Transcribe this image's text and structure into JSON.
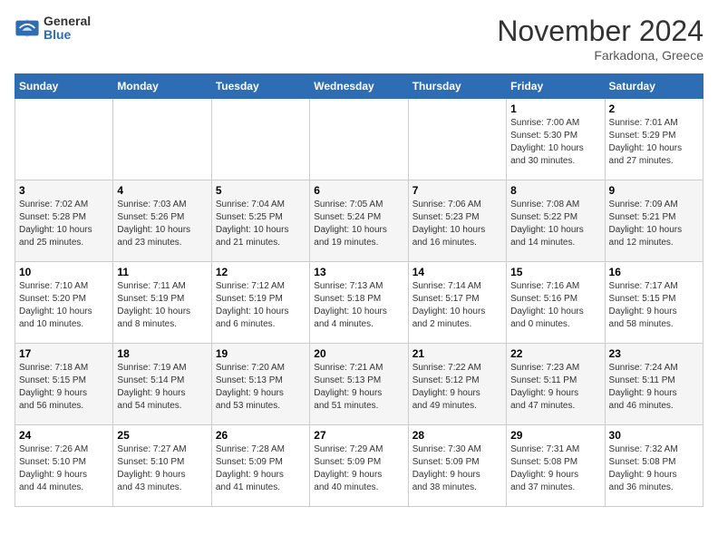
{
  "header": {
    "logo_general": "General",
    "logo_blue": "Blue",
    "month_title": "November 2024",
    "location": "Farkadona, Greece"
  },
  "days_of_week": [
    "Sunday",
    "Monday",
    "Tuesday",
    "Wednesday",
    "Thursday",
    "Friday",
    "Saturday"
  ],
  "weeks": [
    [
      {
        "day": "",
        "info": ""
      },
      {
        "day": "",
        "info": ""
      },
      {
        "day": "",
        "info": ""
      },
      {
        "day": "",
        "info": ""
      },
      {
        "day": "",
        "info": ""
      },
      {
        "day": "1",
        "info": "Sunrise: 7:00 AM\nSunset: 5:30 PM\nDaylight: 10 hours\nand 30 minutes."
      },
      {
        "day": "2",
        "info": "Sunrise: 7:01 AM\nSunset: 5:29 PM\nDaylight: 10 hours\nand 27 minutes."
      }
    ],
    [
      {
        "day": "3",
        "info": "Sunrise: 7:02 AM\nSunset: 5:28 PM\nDaylight: 10 hours\nand 25 minutes."
      },
      {
        "day": "4",
        "info": "Sunrise: 7:03 AM\nSunset: 5:26 PM\nDaylight: 10 hours\nand 23 minutes."
      },
      {
        "day": "5",
        "info": "Sunrise: 7:04 AM\nSunset: 5:25 PM\nDaylight: 10 hours\nand 21 minutes."
      },
      {
        "day": "6",
        "info": "Sunrise: 7:05 AM\nSunset: 5:24 PM\nDaylight: 10 hours\nand 19 minutes."
      },
      {
        "day": "7",
        "info": "Sunrise: 7:06 AM\nSunset: 5:23 PM\nDaylight: 10 hours\nand 16 minutes."
      },
      {
        "day": "8",
        "info": "Sunrise: 7:08 AM\nSunset: 5:22 PM\nDaylight: 10 hours\nand 14 minutes."
      },
      {
        "day": "9",
        "info": "Sunrise: 7:09 AM\nSunset: 5:21 PM\nDaylight: 10 hours\nand 12 minutes."
      }
    ],
    [
      {
        "day": "10",
        "info": "Sunrise: 7:10 AM\nSunset: 5:20 PM\nDaylight: 10 hours\nand 10 minutes."
      },
      {
        "day": "11",
        "info": "Sunrise: 7:11 AM\nSunset: 5:19 PM\nDaylight: 10 hours\nand 8 minutes."
      },
      {
        "day": "12",
        "info": "Sunrise: 7:12 AM\nSunset: 5:19 PM\nDaylight: 10 hours\nand 6 minutes."
      },
      {
        "day": "13",
        "info": "Sunrise: 7:13 AM\nSunset: 5:18 PM\nDaylight: 10 hours\nand 4 minutes."
      },
      {
        "day": "14",
        "info": "Sunrise: 7:14 AM\nSunset: 5:17 PM\nDaylight: 10 hours\nand 2 minutes."
      },
      {
        "day": "15",
        "info": "Sunrise: 7:16 AM\nSunset: 5:16 PM\nDaylight: 10 hours\nand 0 minutes."
      },
      {
        "day": "16",
        "info": "Sunrise: 7:17 AM\nSunset: 5:15 PM\nDaylight: 9 hours\nand 58 minutes."
      }
    ],
    [
      {
        "day": "17",
        "info": "Sunrise: 7:18 AM\nSunset: 5:15 PM\nDaylight: 9 hours\nand 56 minutes."
      },
      {
        "day": "18",
        "info": "Sunrise: 7:19 AM\nSunset: 5:14 PM\nDaylight: 9 hours\nand 54 minutes."
      },
      {
        "day": "19",
        "info": "Sunrise: 7:20 AM\nSunset: 5:13 PM\nDaylight: 9 hours\nand 53 minutes."
      },
      {
        "day": "20",
        "info": "Sunrise: 7:21 AM\nSunset: 5:13 PM\nDaylight: 9 hours\nand 51 minutes."
      },
      {
        "day": "21",
        "info": "Sunrise: 7:22 AM\nSunset: 5:12 PM\nDaylight: 9 hours\nand 49 minutes."
      },
      {
        "day": "22",
        "info": "Sunrise: 7:23 AM\nSunset: 5:11 PM\nDaylight: 9 hours\nand 47 minutes."
      },
      {
        "day": "23",
        "info": "Sunrise: 7:24 AM\nSunset: 5:11 PM\nDaylight: 9 hours\nand 46 minutes."
      }
    ],
    [
      {
        "day": "24",
        "info": "Sunrise: 7:26 AM\nSunset: 5:10 PM\nDaylight: 9 hours\nand 44 minutes."
      },
      {
        "day": "25",
        "info": "Sunrise: 7:27 AM\nSunset: 5:10 PM\nDaylight: 9 hours\nand 43 minutes."
      },
      {
        "day": "26",
        "info": "Sunrise: 7:28 AM\nSunset: 5:09 PM\nDaylight: 9 hours\nand 41 minutes."
      },
      {
        "day": "27",
        "info": "Sunrise: 7:29 AM\nSunset: 5:09 PM\nDaylight: 9 hours\nand 40 minutes."
      },
      {
        "day": "28",
        "info": "Sunrise: 7:30 AM\nSunset: 5:09 PM\nDaylight: 9 hours\nand 38 minutes."
      },
      {
        "day": "29",
        "info": "Sunrise: 7:31 AM\nSunset: 5:08 PM\nDaylight: 9 hours\nand 37 minutes."
      },
      {
        "day": "30",
        "info": "Sunrise: 7:32 AM\nSunset: 5:08 PM\nDaylight: 9 hours\nand 36 minutes."
      }
    ]
  ]
}
